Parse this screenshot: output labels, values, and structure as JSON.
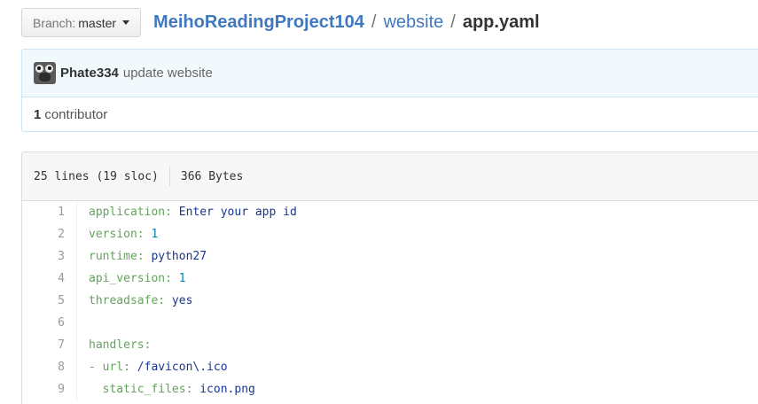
{
  "branch": {
    "prefix": "Branch:",
    "name": "master"
  },
  "breadcrumb": {
    "repo": "MeihoReadingProject104",
    "sep": "/",
    "folder": "website",
    "file": "app.yaml"
  },
  "commit": {
    "author": "Phate334",
    "message": "update website",
    "contributors_count": "1",
    "contributors_label": "contributor"
  },
  "file_info": {
    "lines": "25 lines (19 sloc)",
    "size": "366 Bytes"
  },
  "code_lines": [
    {
      "n": "1",
      "indent": "",
      "dash": "",
      "key": "application:",
      "val": "Enter your app id",
      "vtype": "val"
    },
    {
      "n": "2",
      "indent": "",
      "dash": "",
      "key": "version:",
      "val": "1",
      "vtype": "num"
    },
    {
      "n": "3",
      "indent": "",
      "dash": "",
      "key": "runtime:",
      "val": "python27",
      "vtype": "val"
    },
    {
      "n": "4",
      "indent": "",
      "dash": "",
      "key": "api_version:",
      "val": "1",
      "vtype": "num"
    },
    {
      "n": "5",
      "indent": "",
      "dash": "",
      "key": "threadsafe:",
      "val": "yes",
      "vtype": "val"
    },
    {
      "n": "6",
      "indent": "",
      "dash": "",
      "key": "",
      "val": "",
      "vtype": "val"
    },
    {
      "n": "7",
      "indent": "",
      "dash": "",
      "key": "handlers:",
      "val": "",
      "vtype": "val"
    },
    {
      "n": "8",
      "indent": "",
      "dash": "- ",
      "key": "url:",
      "val": "/favicon\\.ico",
      "vtype": "val"
    },
    {
      "n": "9",
      "indent": "  ",
      "dash": "",
      "key": "static_files:",
      "val": "icon.png",
      "vtype": "val"
    }
  ]
}
